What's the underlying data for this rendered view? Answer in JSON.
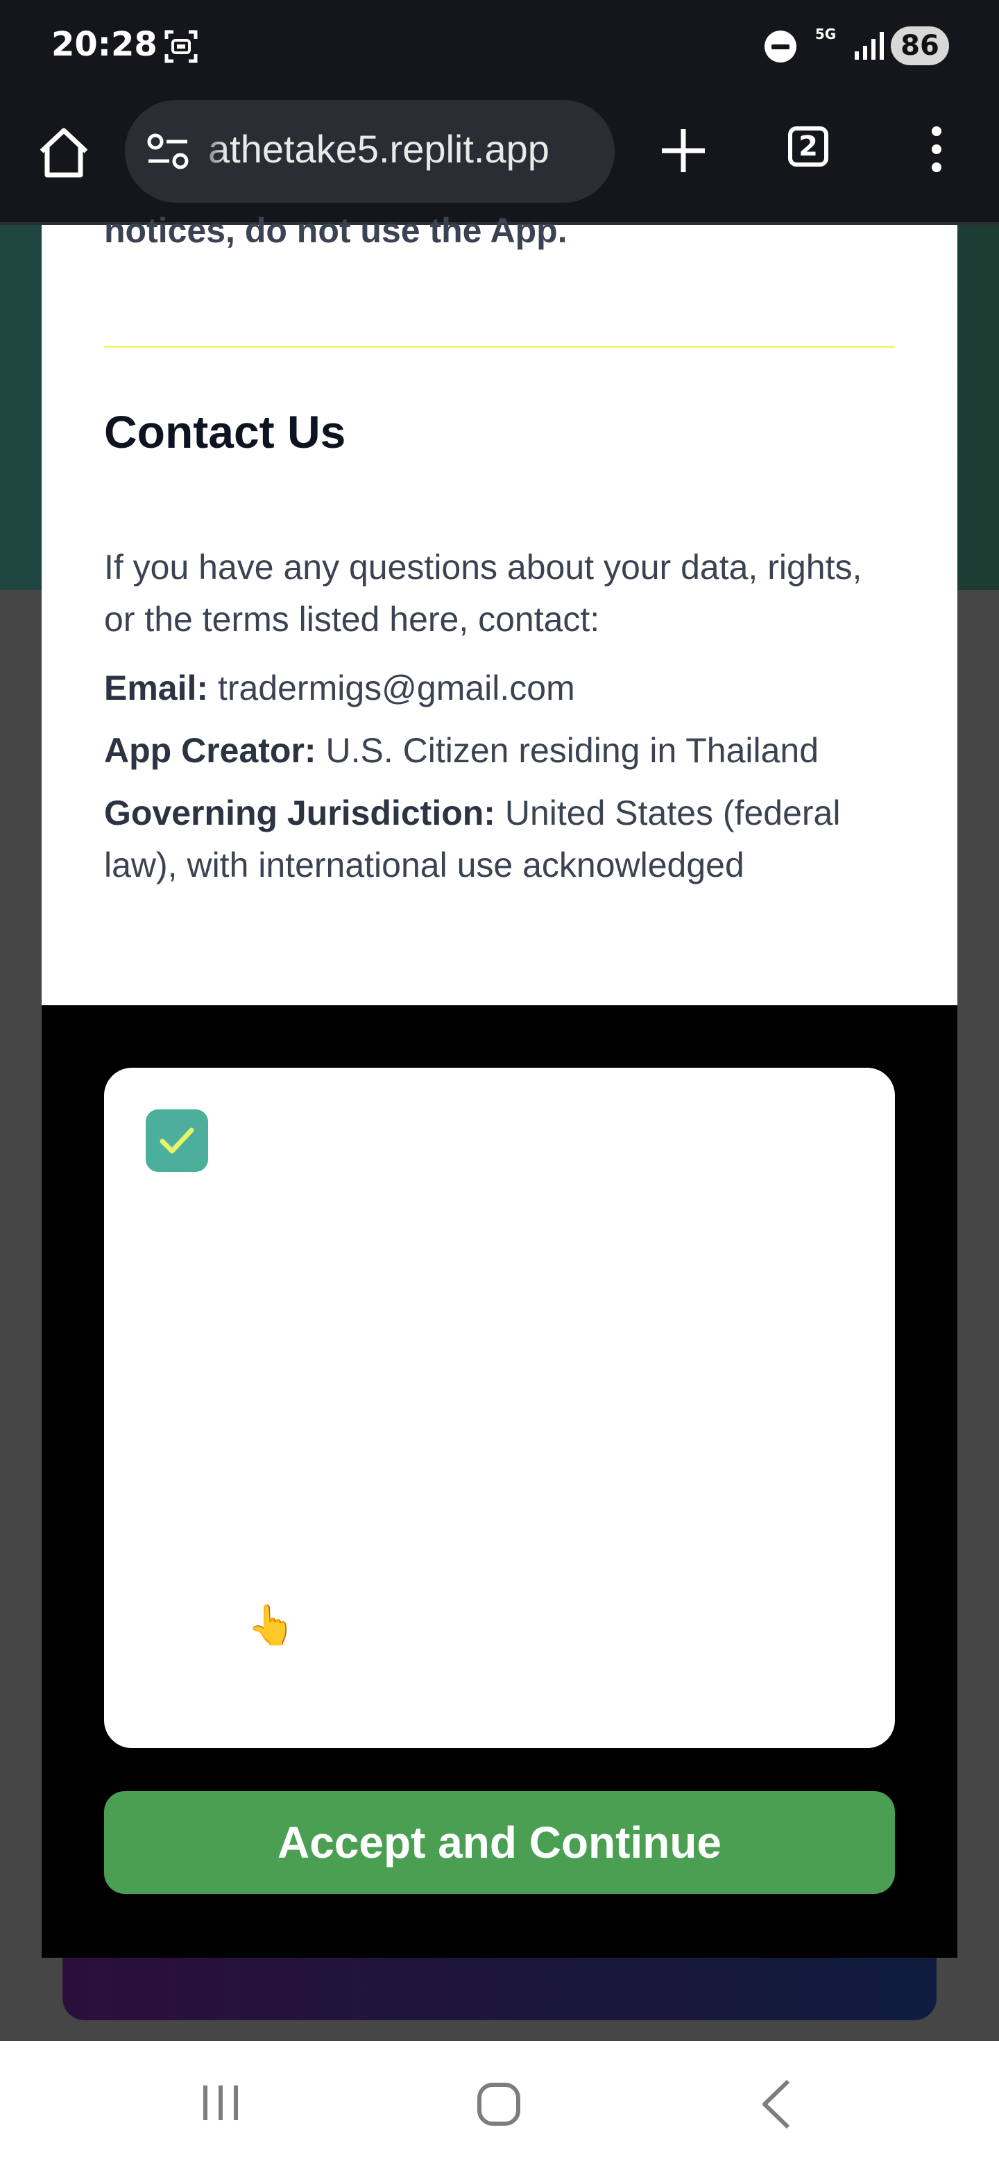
{
  "status_bar": {
    "time": "20:28",
    "network": "5G",
    "battery": "86"
  },
  "browser": {
    "url": "athetake5.replit.app",
    "tab_count": "2"
  },
  "modal": {
    "notice_text": "notices, do not use the App.",
    "contact": {
      "title": "Contact Us",
      "intro": "If you have any questions about your data, rights, or the terms listed here, contact:",
      "email_label": "Email:",
      "email_value": "tradermigs@gmail.com",
      "creator_label": "App Creator:",
      "creator_value": "U.S. Citizen residing in Thailand",
      "jurisdiction_label": "Governing Jurisdiction:",
      "jurisdiction_value": "United States (federal law), with international use acknowledged"
    },
    "agreement_checked": true,
    "accept_label": "Accept and Continue"
  },
  "colors": {
    "accent_green": "#4a9f52",
    "checkbox_teal": "#4caf9c"
  }
}
